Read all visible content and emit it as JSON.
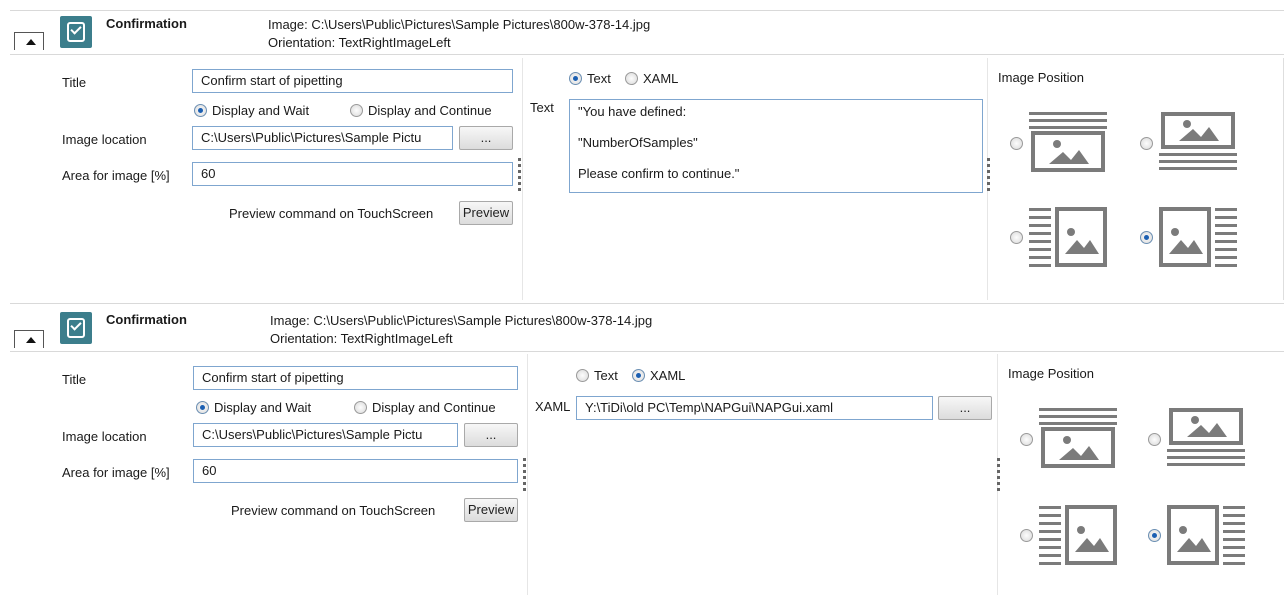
{
  "panels": [
    {
      "title": "Confirmation",
      "info_line1": "Image: C:\\Users\\Public\\Pictures\\Sample Pictures\\800w-378-14.jpg",
      "info_line2": "Orientation: TextRightImageLeft",
      "title_label": "Title",
      "title_value": "Confirm start of pipetting",
      "display_wait": "Display and Wait",
      "display_continue": "Display and Continue",
      "display_selected": "Display and Wait",
      "image_location_label": "Image location",
      "image_location_value": "C:\\Users\\Public\\Pictures\\Sample Pictu",
      "browse_label": "...",
      "area_label": "Area for image [%]",
      "area_value": "60",
      "preview_text": "Preview command on TouchScreen",
      "preview_button": "Preview",
      "mode_text": "Text",
      "mode_xaml": "XAML",
      "mode_selected": "Text",
      "text_label": "Text",
      "text_lines": [
        "\"You have defined:",
        "\"NumberOfSamples\"",
        "Please confirm to continue.\""
      ],
      "image_position_label": "Image Position",
      "image_position_selected": "left"
    },
    {
      "title": "Confirmation",
      "info_line1": "Image: C:\\Users\\Public\\Pictures\\Sample Pictures\\800w-378-14.jpg",
      "info_line2": "Orientation: TextRightImageLeft",
      "title_label": "Title",
      "title_value": "Confirm start of pipetting",
      "display_wait": "Display and Wait",
      "display_continue": "Display and Continue",
      "display_selected": "Display and Wait",
      "image_location_label": "Image location",
      "image_location_value": "C:\\Users\\Public\\Pictures\\Sample Pictu",
      "browse_label": "...",
      "area_label": "Area for image [%]",
      "area_value": "60",
      "preview_text": "Preview command on TouchScreen",
      "preview_button": "Preview",
      "mode_text": "Text",
      "mode_xaml": "XAML",
      "mode_selected": "XAML",
      "xaml_label": "XAML",
      "xaml_value": "Y:\\TiDi\\old PC\\Temp\\NAPGui\\NAPGui.xaml",
      "xaml_browse_label": "...",
      "image_position_label": "Image Position",
      "image_position_selected": "left"
    }
  ],
  "image_position_options": [
    "bottom",
    "top",
    "right",
    "left"
  ],
  "colors": {
    "command_icon": "#3c7e8c",
    "field_border": "#7fa6cf",
    "radio_selected": "#1b5fb2",
    "position_icon": "#7b7b7b"
  }
}
